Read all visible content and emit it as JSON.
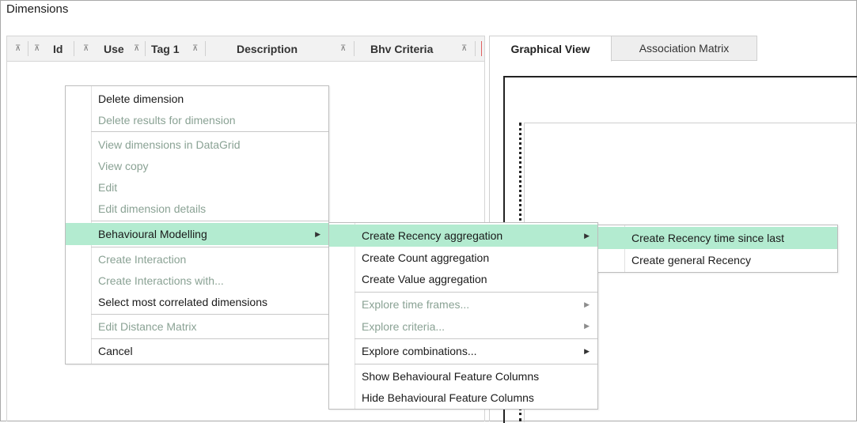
{
  "panel": {
    "title": "Dimensions"
  },
  "grid": {
    "pin_glyph": "⊼",
    "columns": [
      {
        "label": "Id"
      },
      {
        "label": "Use"
      },
      {
        "label": "Tag 1"
      },
      {
        "label": "Description"
      },
      {
        "label": "Bhv Criteria"
      }
    ]
  },
  "tabs": [
    {
      "label": "Graphical View",
      "active": true
    },
    {
      "label": "Association Matrix",
      "active": false
    }
  ],
  "context_menu": {
    "items": [
      {
        "label": "Delete dimension",
        "enabled": true
      },
      {
        "label": "Delete results for dimension",
        "enabled": false
      },
      {
        "label": "View dimensions in DataGrid",
        "enabled": false
      },
      {
        "label": "View copy",
        "enabled": false
      },
      {
        "label": "Edit",
        "enabled": false
      },
      {
        "label": "Edit dimension details",
        "enabled": false
      },
      {
        "label": "Behavioural Modelling",
        "enabled": true,
        "highlighted": true,
        "submenu": true
      },
      {
        "label": "Create Interaction",
        "enabled": false
      },
      {
        "label": "Create Interactions with...",
        "enabled": false
      },
      {
        "label": "Select most correlated dimensions",
        "enabled": true
      },
      {
        "label": "Edit Distance Matrix",
        "enabled": false
      },
      {
        "label": "Cancel",
        "enabled": true
      }
    ]
  },
  "behavioural_submenu": {
    "items": [
      {
        "label": "Create Recency aggregation",
        "enabled": true,
        "highlighted": true,
        "submenu": true
      },
      {
        "label": "Create Count aggregation",
        "enabled": true
      },
      {
        "label": "Create Value aggregation",
        "enabled": true
      },
      {
        "label": "Explore time frames...",
        "enabled": false,
        "submenu": true
      },
      {
        "label": "Explore criteria...",
        "enabled": false,
        "submenu": true
      },
      {
        "label": "Explore combinations...",
        "enabled": true,
        "submenu": true
      },
      {
        "label": "Show Behavioural Feature Columns",
        "enabled": true
      },
      {
        "label": "Hide Behavioural Feature Columns",
        "enabled": true
      }
    ]
  },
  "recency_submenu": {
    "items": [
      {
        "label": "Create Recency time since last",
        "enabled": true,
        "highlighted": true
      },
      {
        "label": "Create general Recency",
        "enabled": true
      }
    ]
  },
  "colors": {
    "highlight": "#b3ebd0",
    "disabled_text": "#8aa294"
  }
}
